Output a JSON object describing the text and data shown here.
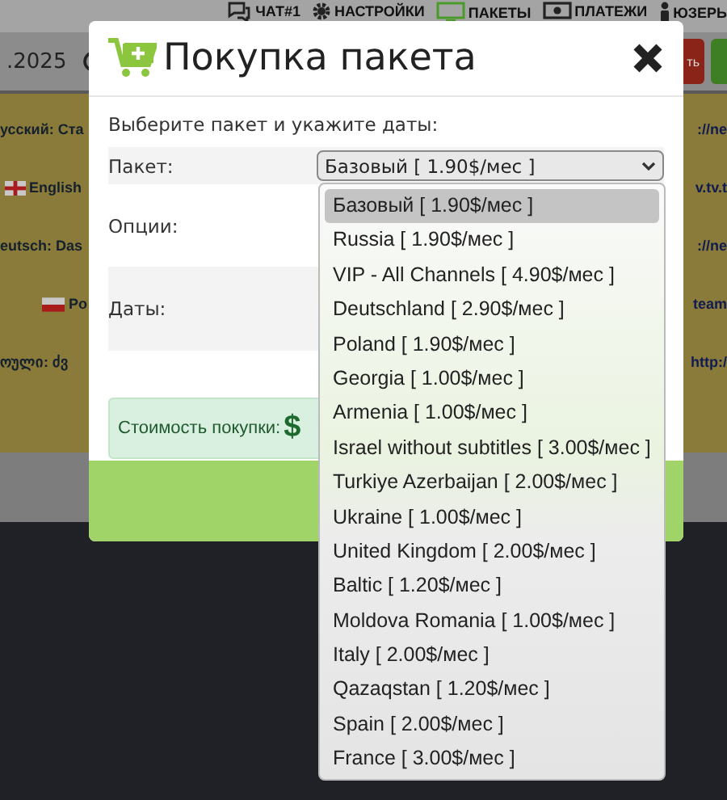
{
  "top_nav": [
    {
      "label": "ЧАТ#1",
      "kind": "chat"
    },
    {
      "label": "НАСТРОЙКИ",
      "kind": "gear"
    },
    {
      "label": "ПАКЕТЫ",
      "kind": "monitor"
    },
    {
      "label": "ПЛАТЕЖИ",
      "kind": "money"
    },
    {
      "label": "ЮЗЕРЬ",
      "kind": "user"
    }
  ],
  "toolbar": {
    "date": ".2025",
    "button_text": "ть"
  },
  "background_rows": [
    {
      "left": "усский: Ста",
      "right": "://ne",
      "kind": "plain"
    },
    {
      "left": "English",
      "right": "v.tv.t",
      "kind": "flag_gb"
    },
    {
      "left": "eutsch: Das",
      "right": "://ne",
      "kind": "plain"
    },
    {
      "left": "Po",
      "right": "team",
      "kind": "flag_pl"
    },
    {
      "left": "ოული: ძვ",
      "right": "http:/",
      "kind": "plain"
    }
  ],
  "modal": {
    "title": "Покупка пакета",
    "instruction": "Выберите пакет и укажите даты:",
    "fields": [
      {
        "label": "Пакет:",
        "kind": "select",
        "value": "Базовый [ 1.90$/мес ]"
      },
      {
        "label": "Опции:",
        "kind": "options"
      },
      {
        "label": "Даты:",
        "kind": "dates"
      }
    ],
    "cost_label": "Стоимость покупки:",
    "cost_symbol": "$"
  },
  "dropdown": [
    {
      "label": "Базовый [ 1.90$/мес ]",
      "selected": true
    },
    {
      "label": "Russia [ 1.90$/мес ]",
      "selected": false
    },
    {
      "label": "VIP - All Channels [ 4.90$/мес ]",
      "selected": false
    },
    {
      "label": "Deutschland [ 2.90$/мес ]",
      "selected": false
    },
    {
      "label": "Poland [ 1.90$/мес ]",
      "selected": false
    },
    {
      "label": "Georgia [ 1.00$/мес ]",
      "selected": false
    },
    {
      "label": "Armenia [ 1.00$/мес ]",
      "selected": false
    },
    {
      "label": "Israel without subtitles [ 3.00$/мес ]",
      "selected": false
    },
    {
      "label": "Turkiye Azerbaijan [ 2.00$/мес ]",
      "selected": false
    },
    {
      "label": "Ukraine [ 1.00$/мес ]",
      "selected": false
    },
    {
      "label": "United Kingdom [ 2.00$/мес ]",
      "selected": false
    },
    {
      "label": "Baltic [ 1.20$/мес ]",
      "selected": false
    },
    {
      "label": "Moldova Romania [ 1.00$/мес ]",
      "selected": false
    },
    {
      "label": "Italy [ 2.00$/мес ]",
      "selected": false
    },
    {
      "label": "Qazaqstan [ 1.20$/мес ]",
      "selected": false
    },
    {
      "label": "Spain [ 2.00$/мес ]",
      "selected": false
    },
    {
      "label": "France [ 3.00$/мес ]",
      "selected": false
    }
  ]
}
